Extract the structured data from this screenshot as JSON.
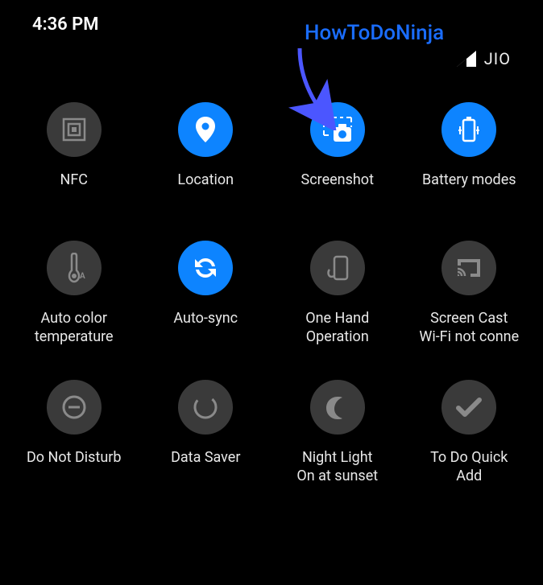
{
  "status": {
    "time": "4:36 PM",
    "carrier": "JIO"
  },
  "annotation": {
    "watermark": "HowToDoNinja"
  },
  "tiles": {
    "nfc": {
      "label": "NFC",
      "active": false
    },
    "location": {
      "label": "Location",
      "active": true
    },
    "screenshot": {
      "label": "Screenshot",
      "active": true
    },
    "battery": {
      "label": "Battery modes",
      "active": true
    },
    "autocolor": {
      "label": "Auto color\ntemperature",
      "active": false
    },
    "autosync": {
      "label": "Auto-sync",
      "active": true
    },
    "onehand": {
      "label": "One Hand\nOperation",
      "active": false
    },
    "cast": {
      "label": "Screen Cast\nWi-Fi not conne",
      "active": false
    },
    "dnd": {
      "label": "Do Not Disturb",
      "active": false
    },
    "datasaver": {
      "label": "Data Saver",
      "active": false
    },
    "nightlight": {
      "label": "Night Light\nOn at sunset",
      "active": false
    },
    "todo": {
      "label": "To Do Quick\nAdd",
      "active": false
    }
  },
  "colors": {
    "accent": "#0d84ff",
    "inactive": "#3a3a3a",
    "annotation": "#4b56ff"
  }
}
